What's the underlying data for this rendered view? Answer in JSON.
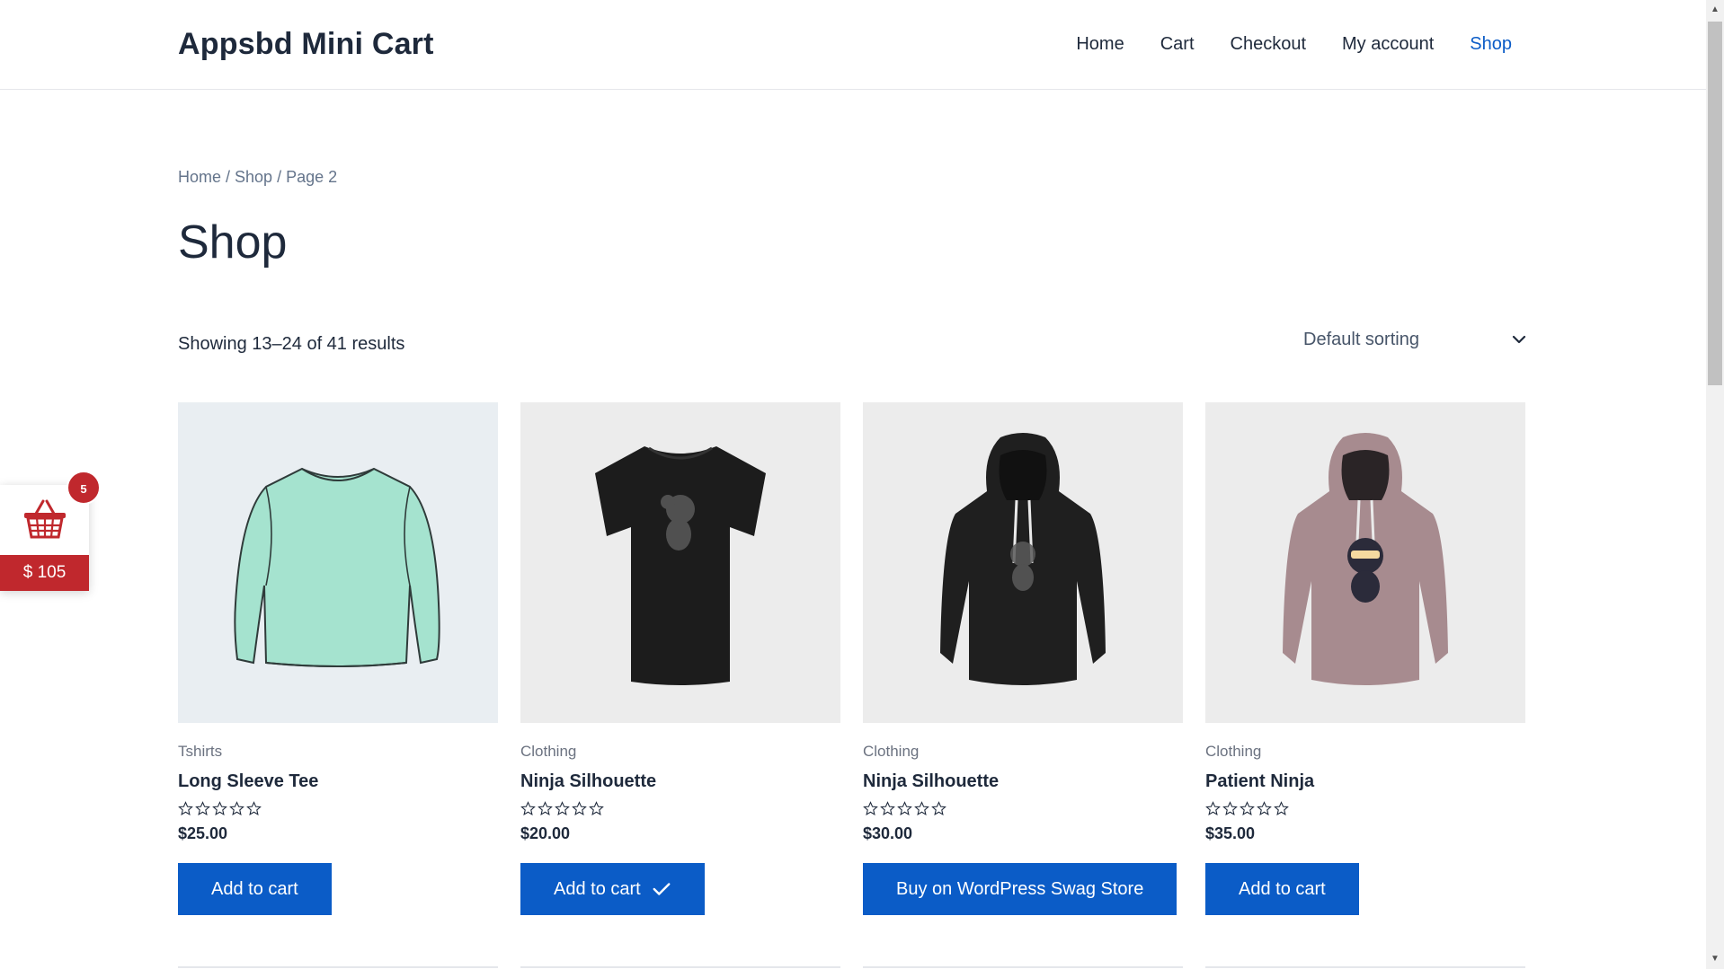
{
  "site": {
    "title": "Appsbd Mini Cart"
  },
  "nav": [
    {
      "label": "Home",
      "active": false
    },
    {
      "label": "Cart",
      "active": false
    },
    {
      "label": "Checkout",
      "active": false
    },
    {
      "label": "My account",
      "active": false
    },
    {
      "label": "Shop",
      "active": true
    }
  ],
  "breadcrumb": {
    "home": "Home",
    "sep1": " / ",
    "shop": "Shop",
    "sep2": " / ",
    "current": "Page 2"
  },
  "page_title": "Shop",
  "result_count": "Showing 13–24 of 41 results",
  "sorting": {
    "selected": "Default sorting"
  },
  "products": [
    {
      "category": "Tshirts",
      "name": "Long Sleeve Tee",
      "price": "$25.00",
      "button": "Add to cart",
      "image": "long-sleeve-tee-image",
      "rating_stars": 5,
      "rating": 0
    },
    {
      "category": "Clothing",
      "name": "Ninja Silhouette",
      "price": "$20.00",
      "button": "Add to cart",
      "added": true,
      "image": "black-tshirt-image",
      "rating_stars": 5,
      "rating": 0
    },
    {
      "category": "Clothing",
      "name": "Ninja Silhouette",
      "price": "$30.00",
      "button": "Buy on WordPress Swag Store",
      "image": "black-hoodie-image",
      "rating_stars": 5,
      "rating": 0
    },
    {
      "category": "Clothing",
      "name": "Patient Ninja",
      "price": "$35.00",
      "button": "Add to cart",
      "image": "pink-hoodie-image",
      "rating_stars": 5,
      "rating": 0
    }
  ],
  "mini_cart": {
    "count": "5",
    "total": "$ 105",
    "icon": "basket-icon"
  },
  "colors": {
    "accent": "#0b5cc7",
    "cart_red": "#c0282d",
    "text": "#1e293b"
  }
}
